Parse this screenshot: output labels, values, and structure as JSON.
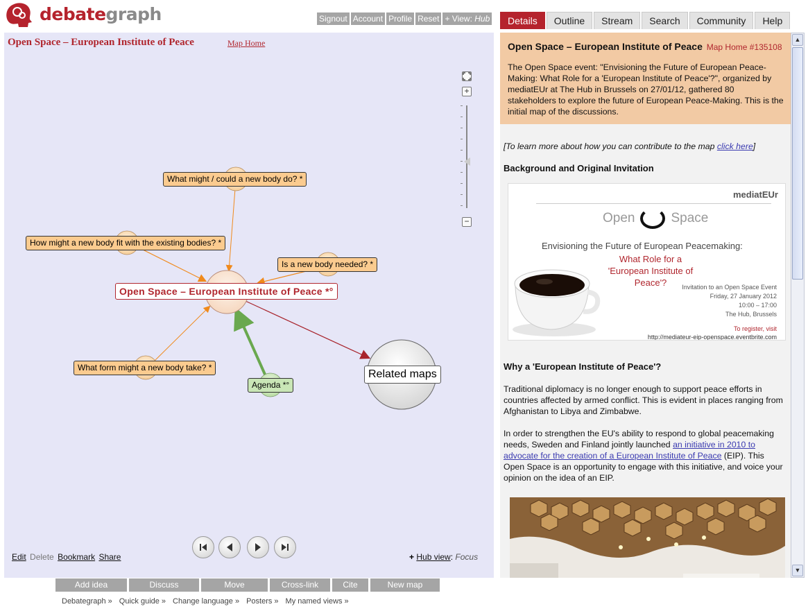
{
  "header": {
    "logo": {
      "word_part1": "debate",
      "word_part2": "graph"
    },
    "top_links": [
      "Signout",
      "Account",
      "Profile",
      "Reset"
    ],
    "view_prefix": "+ View:",
    "view_value": "Hub"
  },
  "map": {
    "title": "Open Space – European Institute of Peace",
    "home_link": "Map Home",
    "nodes": {
      "central": "Open Space – European Institute of Peace *°",
      "q1": "What might / could a new body do? *",
      "q2": "How might a new body fit with the existing bodies? *",
      "q3": "Is a new body needed? *",
      "q4": "What form might a new body take? *",
      "agenda": "Agenda *°",
      "related": "Related maps"
    },
    "zoom": {
      "fit_icon": "fit-screen-icon",
      "in": "+",
      "out": "−"
    },
    "playback": [
      "first-icon",
      "previous-icon",
      "next-icon",
      "last-icon"
    ],
    "bottom_left": {
      "edit": "Edit",
      "delete": "Delete",
      "bookmark": "Bookmark",
      "share": "Share"
    },
    "bottom_right": {
      "prefix": "+",
      "hub_view": "Hub view",
      "sep": ":",
      "focus": "Focus"
    }
  },
  "actions": [
    "Add idea",
    "Discuss",
    "Move",
    "Cross-link",
    "Cite",
    "New map"
  ],
  "footer_links": [
    "Debategraph »",
    "Quick guide »",
    "Change language »",
    "Posters »",
    "My named views »"
  ],
  "tabs": [
    "Details",
    "Outline",
    "Stream",
    "Search",
    "Community",
    "Help"
  ],
  "active_tab": "Details",
  "detail": {
    "title": "Open Space – European Institute of Peace",
    "home_ref": "Map Home #135108",
    "description": "The Open Space event: \"Envisioning the Future of European Peace-Making: What Role for a 'European Institute of Peace'?\", organized by mediatEUr at The Hub in Brussels on 27/01/12, gathered 80 stakeholders to explore the future of European Peace-Making. This is the initial map of the discussions.",
    "learn_prefix": "[To learn more about how you can contribute to the map ",
    "learn_link": "click here",
    "learn_suffix": "]",
    "background_heading": "Background and Original Invitation",
    "flyer": {
      "logo": "mediatEUr",
      "open": "Open",
      "space": "Space",
      "line1": "Envisioning the Future of European Peacemaking:",
      "line2": "What Role for a",
      "line3": "'European Institute of Peace'?",
      "line4": "Invitation to an Open Space Event",
      "line5": "Friday, 27 January 2012",
      "line6": "10:00 – 17:00",
      "line7": "The Hub, Brussels",
      "line8": "To register, visit",
      "line9": "http://mediateur-eip-openspace.eventbrite.com"
    },
    "why_heading": "Why a 'European Institute of Peace'?",
    "para1": "Traditional diplomacy is no longer enough to support peace efforts in countries affected by armed conflict. This is evident in places ranging from Afghanistan to Libya and Zimbabwe.",
    "para2_prefix": "In order to strengthen the EU's ability to respond to global peacemaking needs, Sweden and Finland jointly launched ",
    "para2_link": "an initiative in 2010 to advocate for the creation of a European Institute of Peace",
    "para2_suffix": " (EIP). This Open Space is an opportunity to engage with this initiative, and voice your opinion on the idea of an EIP."
  },
  "colors": {
    "brand": "#b5232d",
    "map_bg": "#e6e6f7",
    "question_node": "#fbcb8f",
    "agenda_node": "#c9e6b6",
    "detail_head_bg": "#f2caa4",
    "button_grey": "#a5a5a5"
  }
}
